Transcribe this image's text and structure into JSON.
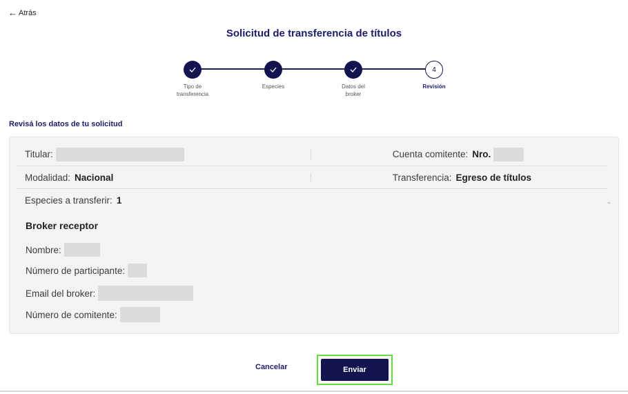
{
  "nav": {
    "back_label": "Atrás"
  },
  "page": {
    "title": "Solicitud de transferencia de títulos"
  },
  "stepper": {
    "steps": [
      {
        "label": "Tipo de transferencia",
        "state": "done"
      },
      {
        "label": "Especies",
        "state": "done"
      },
      {
        "label": "Datos del broker",
        "state": "done"
      },
      {
        "label": "Revisión",
        "state": "current",
        "number": "4"
      }
    ]
  },
  "review": {
    "heading": "Revisá los datos de tu solicitud",
    "titular_label": "Titular:",
    "cuenta_label": "Cuenta comitente:",
    "cuenta_value": "Nro.",
    "modalidad_label": "Modalidad:",
    "modalidad_value": "Nacional",
    "transferencia_label": "Transferencia:",
    "transferencia_value": "Egreso de títulos",
    "especies_label": "Especies a transferir:",
    "especies_value": "1"
  },
  "broker": {
    "title": "Broker receptor",
    "nombre_label": "Nombre:",
    "participante_label": "Número de participante:",
    "email_label": "Email del broker:",
    "comitente_label": "Número de comitente:"
  },
  "actions": {
    "cancel_label": "Cancelar",
    "send_label": "Enviar"
  },
  "colors": {
    "primary": "#13134f",
    "heading": "#1c1c6b",
    "highlight": "#64dc3c",
    "card_bg": "#f4f4f4"
  }
}
